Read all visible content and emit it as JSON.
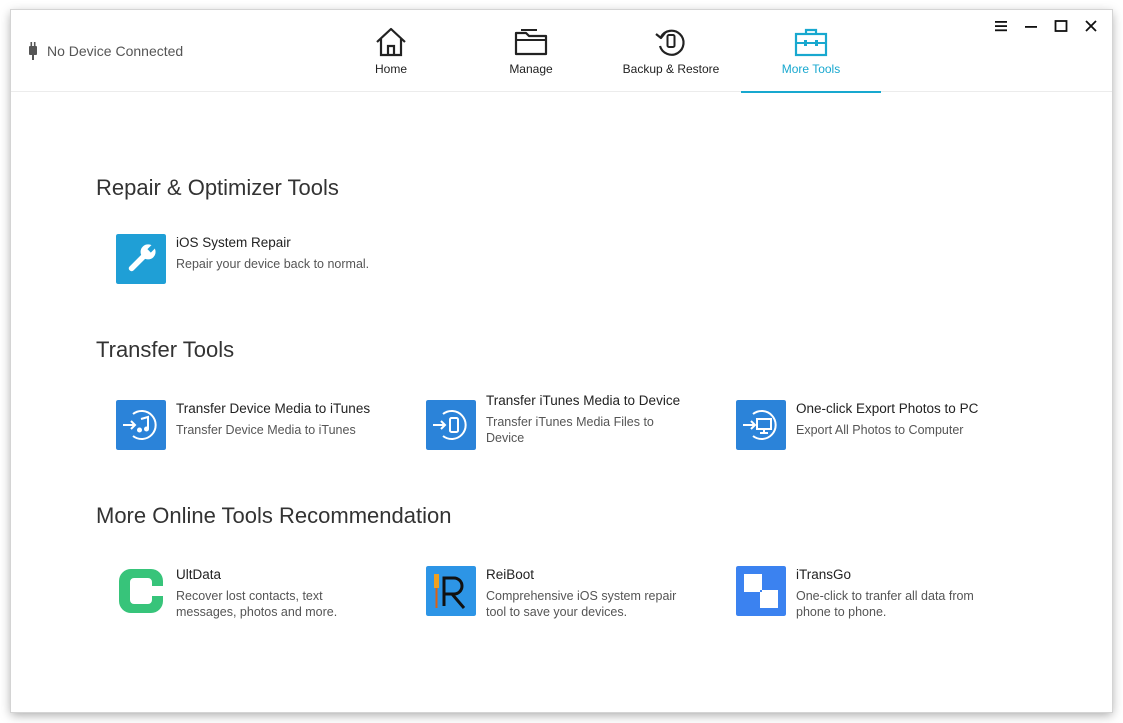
{
  "header": {
    "device_status": "No Device Connected",
    "tabs": [
      {
        "label": "Home",
        "icon": "home-icon"
      },
      {
        "label": "Manage",
        "icon": "folder-icon"
      },
      {
        "label": "Backup & Restore",
        "icon": "backup-restore-icon"
      },
      {
        "label": "More Tools",
        "icon": "toolbox-icon",
        "active": true
      }
    ],
    "accent_color": "#18a8cf"
  },
  "sections": {
    "repair": {
      "title": "Repair & Optimizer Tools",
      "tools": [
        {
          "name": "iOS System Repair",
          "desc": "Repair your device back to normal.",
          "icon": "wrench-icon"
        }
      ]
    },
    "transfer": {
      "title": "Transfer Tools",
      "tools": [
        {
          "name": "Transfer Device Media to iTunes",
          "desc": "Transfer Device Media to iTunes",
          "icon": "music-transfer-icon"
        },
        {
          "name": "Transfer iTunes Media to Device",
          "desc": "Transfer iTunes Media Files to Device",
          "icon": "device-transfer-icon"
        },
        {
          "name": "One-click Export Photos to PC",
          "desc": "Export All Photos to Computer",
          "icon": "pc-export-icon"
        }
      ]
    },
    "online": {
      "title": "More Online Tools Recommendation",
      "tools": [
        {
          "name": "UltData",
          "desc": "Recover lost contacts, text messages, photos and more.",
          "icon": "ultdata-icon"
        },
        {
          "name": "ReiBoot",
          "desc": "Comprehensive iOS system repair tool to save your devices.",
          "icon": "reiboot-icon"
        },
        {
          "name": "iTransGo",
          "desc": "One-click to tranfer all data from phone to phone.",
          "icon": "itransgo-icon"
        }
      ]
    }
  }
}
